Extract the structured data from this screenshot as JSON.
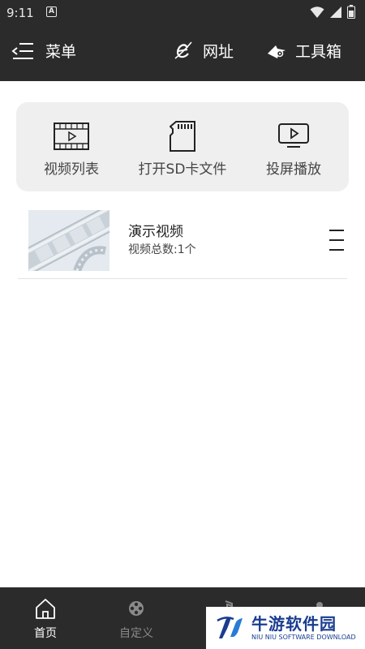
{
  "status_bar": {
    "time": "9:11",
    "notification_icon": "A"
  },
  "topbar": {
    "menu_label": "菜单",
    "url_label": "网址",
    "tools_label": "工具箱"
  },
  "quick_actions": [
    {
      "label": "视频列表",
      "icon": "film-icon"
    },
    {
      "label": "打开SD卡文件",
      "icon": "sd-card-icon"
    },
    {
      "label": "投屏播放",
      "icon": "cast-screen-icon"
    }
  ],
  "video_list": [
    {
      "title": "演示视频",
      "count_text": "视频总数:1个"
    }
  ],
  "bottom_nav": [
    {
      "label": "首页",
      "icon": "home-icon",
      "active": true
    },
    {
      "label": "自定义",
      "icon": "film-reel-icon",
      "active": false
    },
    {
      "label": "",
      "icon": "music-icon",
      "active": false
    },
    {
      "label": "",
      "icon": "profile-icon",
      "active": false
    }
  ],
  "watermark": {
    "title": "牛游软件园",
    "subtitle": "NIU NIU SOFTWARE DOWNLOAD"
  },
  "colors": {
    "bar_background": "#2b2b2b",
    "panel_background": "#efefef",
    "watermark_blue": "#1a3d8f"
  }
}
